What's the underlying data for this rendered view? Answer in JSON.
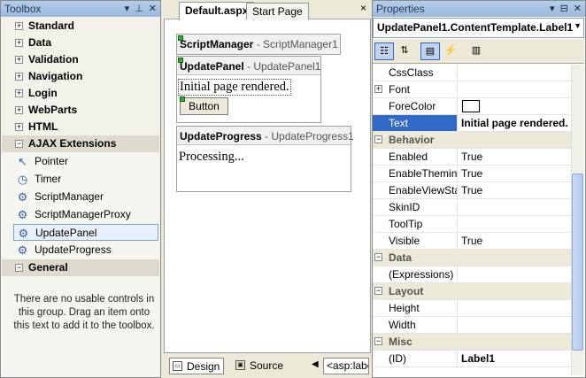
{
  "toolbox": {
    "title": "Toolbox",
    "categories_top": [
      "Standard",
      "Data",
      "Validation",
      "Navigation",
      "Login",
      "WebParts",
      "HTML"
    ],
    "ajax_label": "AJAX Extensions",
    "tools": [
      {
        "label": "Pointer",
        "icon": "pointer-icon"
      },
      {
        "label": "Timer",
        "icon": "timer-icon"
      },
      {
        "label": "ScriptManager",
        "icon": "gear-icon"
      },
      {
        "label": "ScriptManagerProxy",
        "icon": "gear-icon"
      },
      {
        "label": "UpdatePanel",
        "icon": "gear-icon"
      },
      {
        "label": "UpdateProgress",
        "icon": "gear-icon"
      }
    ],
    "general_label": "General",
    "empty_message": "There are no usable controls in this group. Drag an item onto this text to add it to the toolbox.",
    "expand_glyph": "+",
    "collapse_glyph": "−"
  },
  "editor": {
    "tabs": [
      "Default.aspx",
      "Start Page"
    ],
    "close_glyph": "×",
    "script_manager": {
      "type": "ScriptManager",
      "name": "ScriptManager1"
    },
    "update_panel": {
      "type": "UpdatePanel",
      "name": "UpdatePanel1",
      "text": "Initial page rendered.",
      "button": "Button"
    },
    "update_progress": {
      "type": "UpdateProgress",
      "name": "UpdateProgress1",
      "text": "Processing..."
    },
    "bottom": {
      "design": "Design",
      "source": "Source",
      "tag": "<asp:label>"
    }
  },
  "properties": {
    "title": "Properties",
    "object": "UpdatePanel1.ContentTemplate.Label1",
    "rows": [
      {
        "kind": "prop",
        "name": "CssClass",
        "value": ""
      },
      {
        "kind": "prop",
        "name": "Font",
        "value": "",
        "expand": true
      },
      {
        "kind": "prop",
        "name": "ForeColor",
        "value": "",
        "swatch": true
      },
      {
        "kind": "prop",
        "name": "Text",
        "value": "Initial page rendered.",
        "selected": true,
        "bold": true
      },
      {
        "kind": "section",
        "name": "Behavior"
      },
      {
        "kind": "prop",
        "name": "Enabled",
        "value": "True"
      },
      {
        "kind": "prop",
        "name": "EnableTheming",
        "value": "True"
      },
      {
        "kind": "prop",
        "name": "EnableViewState",
        "value": "True"
      },
      {
        "kind": "prop",
        "name": "SkinID",
        "value": ""
      },
      {
        "kind": "prop",
        "name": "ToolTip",
        "value": ""
      },
      {
        "kind": "prop",
        "name": "Visible",
        "value": "True"
      },
      {
        "kind": "section",
        "name": "Data"
      },
      {
        "kind": "prop",
        "name": "(Expressions)",
        "value": ""
      },
      {
        "kind": "section",
        "name": "Layout"
      },
      {
        "kind": "prop",
        "name": "Height",
        "value": ""
      },
      {
        "kind": "prop",
        "name": "Width",
        "value": ""
      },
      {
        "kind": "section",
        "name": "Misc"
      },
      {
        "kind": "prop",
        "name": "(ID)",
        "value": "Label1",
        "bold": true
      }
    ]
  }
}
